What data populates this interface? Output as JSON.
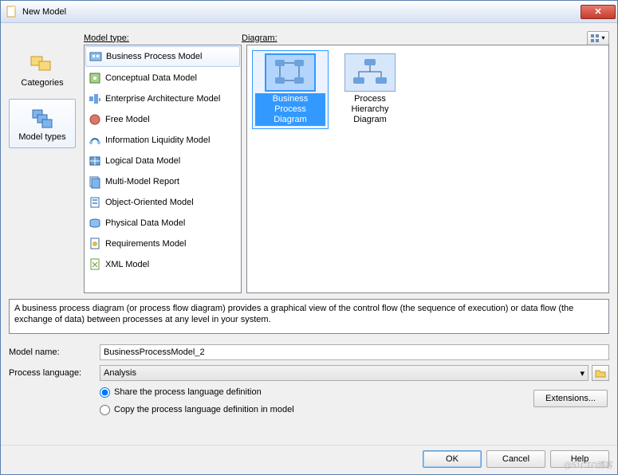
{
  "window": {
    "title": "New Model",
    "close": "✕"
  },
  "sidebar": {
    "items": [
      {
        "label": "Categories"
      },
      {
        "label": "Model types"
      }
    ],
    "selected": 1
  },
  "columns": {
    "model_type": "Model type:",
    "diagram": "Diagram:"
  },
  "view_menu_icon": "▾",
  "model_types": [
    "Business Process Model",
    "Conceptual Data Model",
    "Enterprise Architecture Model",
    "Free Model",
    "Information Liquidity Model",
    "Logical Data Model",
    "Multi-Model Report",
    "Object-Oriented Model",
    "Physical Data Model",
    "Requirements Model",
    "XML Model"
  ],
  "model_types_selected": 0,
  "diagrams": [
    {
      "label": "Business Process Diagram"
    },
    {
      "label": "Process Hierarchy Diagram"
    }
  ],
  "diagrams_selected": 0,
  "description": "A business process diagram (or process flow diagram) provides a graphical view of the control flow (the sequence of execution) or data flow (the exchange of data) between processes at any level in your system.",
  "form": {
    "model_name_label": "Model name:",
    "model_name_value": "BusinessProcessModel_2",
    "process_language_label": "Process language:",
    "process_language_value": "Analysis",
    "radio_share": "Share the process language definition",
    "radio_copy": "Copy the process language definition in model",
    "radio_selected": "share",
    "extensions": "Extensions..."
  },
  "buttons": {
    "ok": "OK",
    "cancel": "Cancel",
    "help": "Help"
  },
  "watermark": "@51CTO博客"
}
